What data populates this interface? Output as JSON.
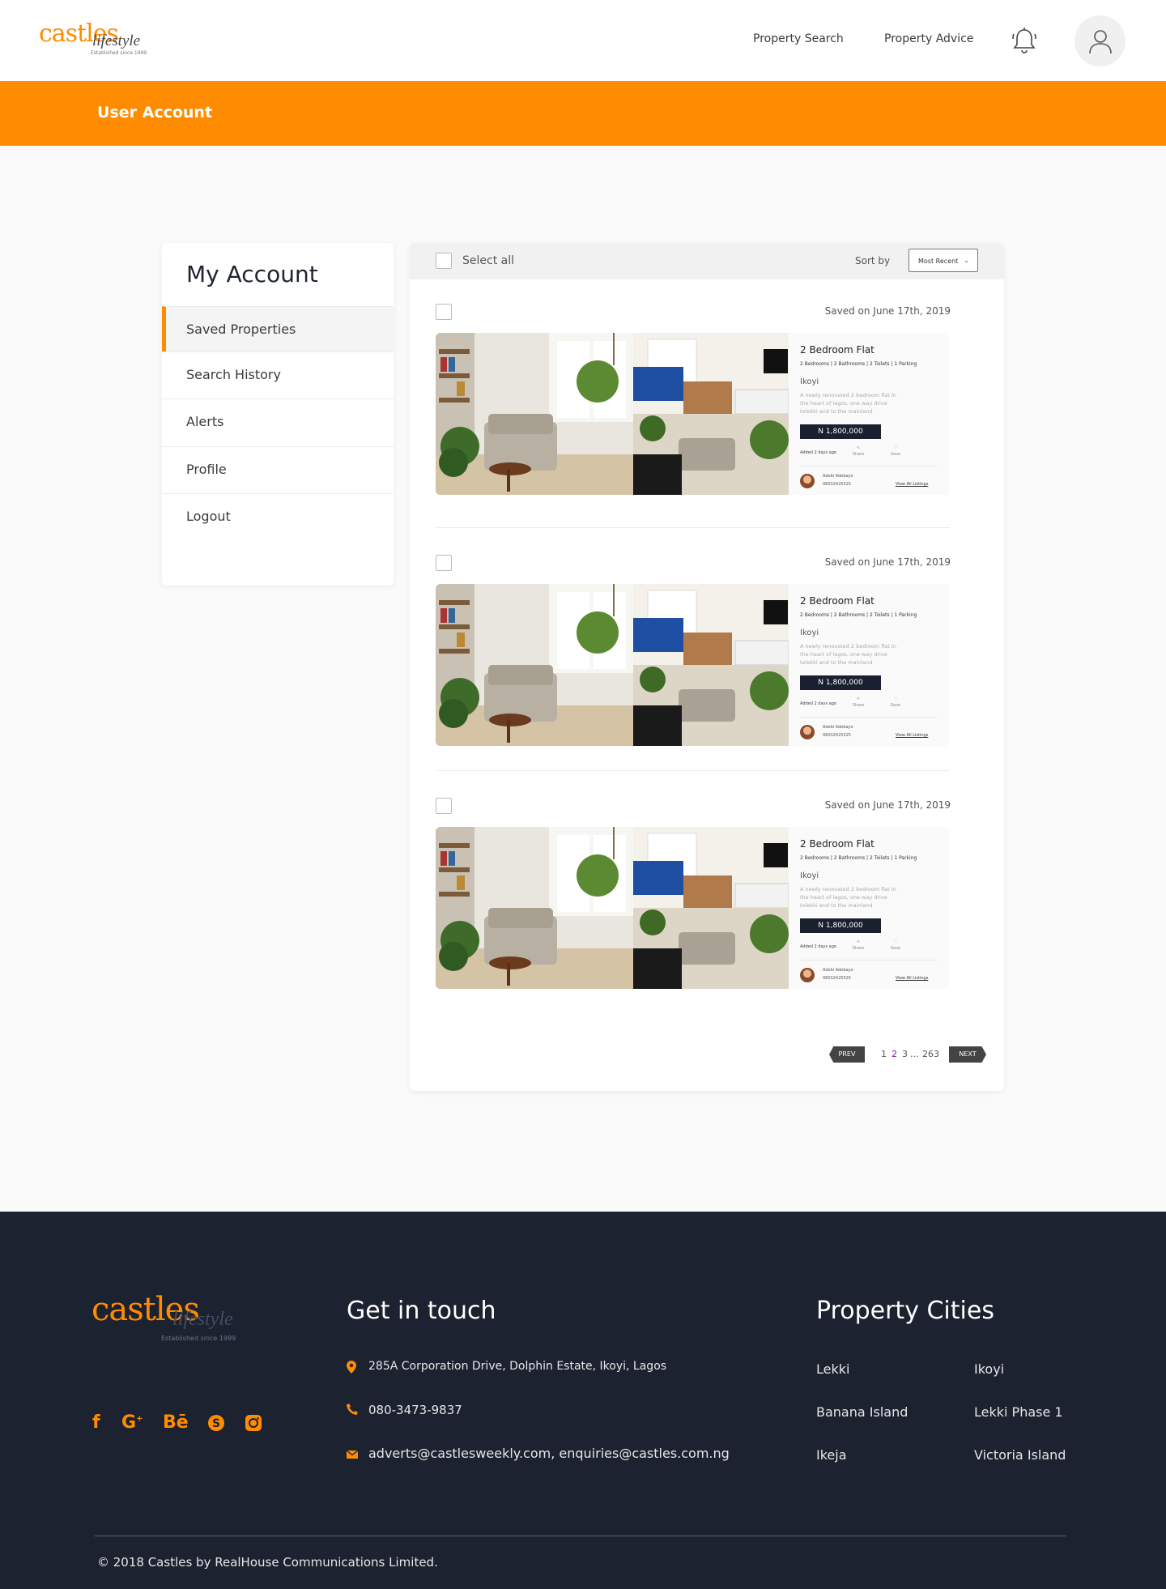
{
  "header": {
    "logo": {
      "main": "castles",
      "script": "lifestyle",
      "tagline": "Established since 1999"
    },
    "nav": [
      "Property Search",
      "Property Advice"
    ]
  },
  "banner": {
    "title": "User Account"
  },
  "sidebar": {
    "title": "My Account",
    "items": [
      "Saved Properties",
      "Search History",
      "Alerts",
      "Profile",
      "Logout"
    ]
  },
  "toolbar": {
    "select_all": "Select all",
    "sort_label": "Sort by",
    "sort_value": "Most Recent"
  },
  "listings": [
    {
      "saved": "Saved on June 17th, 2019",
      "title": "2 Bedroom Flat",
      "specs": "2 Bedrooms  |  2 Bathrooms  |  2 Toilets | 1 Parking",
      "location": "Ikoyi",
      "description": "A newly renovated 2 bedroom flat in the heart of lagos, one way drive tolekki and to the mainland",
      "price": "N 1,800,000",
      "added": "Added 2 days ago",
      "share": "Share",
      "save": "Save",
      "agent": "Adebi Adebayo",
      "phone": "08032425525",
      "view_all": "View All Listings"
    },
    {
      "saved": "Saved on June 17th, 2019",
      "title": "2 Bedroom Flat",
      "specs": "2 Bedrooms  |  2 Bathrooms  |  2 Toilets | 1 Parking",
      "location": "Ikoyi",
      "description": "A newly renovated 2 bedroom flat in the heart of lagos, one way drive tolekki and to the mainland",
      "price": "N 1,800,000",
      "added": "Added 2 days ago",
      "share": "Share",
      "save": "Save",
      "agent": "Adebi Adebayo",
      "phone": "08032425525",
      "view_all": "View All Listings"
    },
    {
      "saved": "Saved on June 17th, 2019",
      "title": "2 Bedroom Flat",
      "specs": "2 Bedrooms  |  2 Bathrooms  |  2 Toilets | 1 Parking",
      "location": "Ikoyi",
      "description": "A newly renovated 2 bedroom flat in the heart of lagos, one way drive tolekki and to the mainland",
      "price": "N 1,800,000",
      "added": "Added 2 days ago",
      "share": "Share",
      "save": "Save",
      "agent": "Adebi Adebayo",
      "phone": "08032425525",
      "view_all": "View All Listings"
    }
  ],
  "pagination": {
    "prev": "PREV",
    "next": "NEXT",
    "pages": [
      "1",
      "2",
      "3",
      "...",
      "263"
    ],
    "current": "2"
  },
  "footer": {
    "logo": {
      "main": "castles",
      "script": "lifestyle",
      "tagline": "Established since 1999"
    },
    "social": [
      "facebook-icon",
      "google-plus-icon",
      "behance-icon",
      "skype-icon",
      "instagram-icon"
    ],
    "contact_heading": "Get in touch",
    "address": "285A Corporation Drive, Dolphin Estate, Ikoyi, Lagos",
    "phone": "080-3473-9837",
    "email": "adverts@castlesweekly.com, enquiries@castles.com.ng",
    "cities_heading": "Property Cities",
    "cities": [
      "Lekki",
      "Ikoyi",
      "Banana Island",
      "Lekki Phase 1",
      "Ikeja",
      "Victoria Island"
    ],
    "copyright": "© 2018 Castles by RealHouse Communications Limited."
  },
  "colors": {
    "accent": "#ff8c00",
    "footer_bg": "#1d2230",
    "price_bg": "#1b2030"
  }
}
